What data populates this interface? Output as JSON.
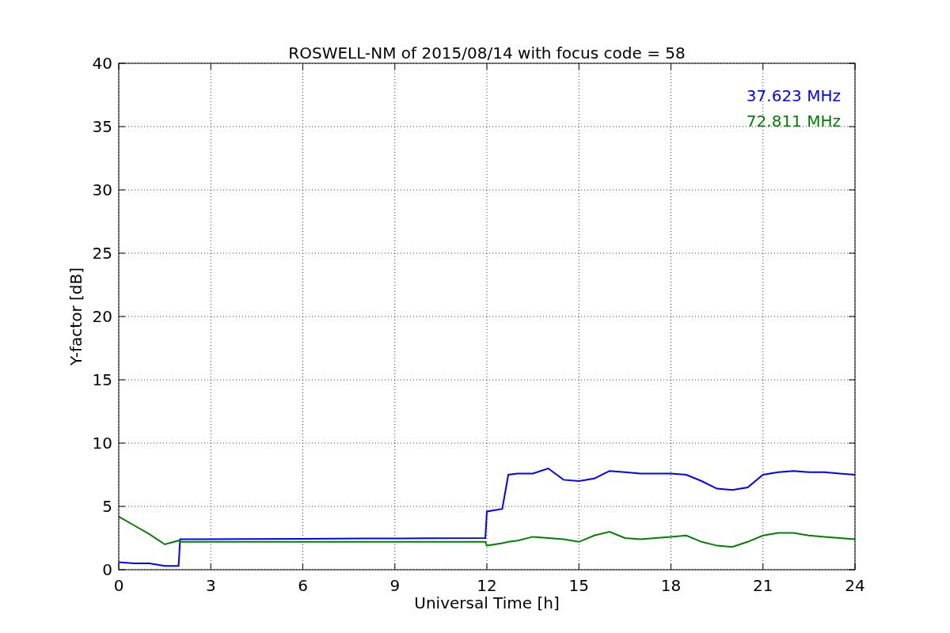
{
  "chart_data": {
    "type": "line",
    "title": "ROSWELL-NM of 2015/08/14 with focus code = 58",
    "xlabel": "Universal Time [h]",
    "ylabel": "Y-factor [dB]",
    "xlim": [
      0,
      24
    ],
    "ylim": [
      0,
      40
    ],
    "xticks": [
      0,
      3,
      6,
      9,
      12,
      15,
      18,
      21,
      24
    ],
    "yticks": [
      0,
      5,
      10,
      15,
      20,
      25,
      30,
      35,
      40
    ],
    "grid": true,
    "x": [
      0,
      0.5,
      1,
      1.5,
      1.95,
      2,
      4,
      6,
      8,
      10,
      11.95,
      12,
      12.5,
      12.7,
      13,
      13.5,
      14,
      14.5,
      15,
      15.5,
      16,
      16.5,
      17,
      17.5,
      18,
      18.5,
      19,
      19.5,
      20,
      20.5,
      21,
      21.5,
      22,
      22.5,
      23,
      23.5,
      24
    ],
    "series": [
      {
        "name": "37.623 MHz",
        "color": "#0000ff",
        "values": [
          0.6,
          0.5,
          0.5,
          0.3,
          0.3,
          2.4,
          2.42,
          2.44,
          2.46,
          2.48,
          2.5,
          4.6,
          4.8,
          7.5,
          7.6,
          7.6,
          8.0,
          7.1,
          7.0,
          7.2,
          7.8,
          7.7,
          7.6,
          7.6,
          7.6,
          7.5,
          7.0,
          6.4,
          6.3,
          6.5,
          7.5,
          7.7,
          7.8,
          7.7,
          7.7,
          7.6,
          7.5
        ]
      },
      {
        "name": "72.811 MHz",
        "color": "#008000",
        "values": [
          4.2,
          3.5,
          2.8,
          2.0,
          2.3,
          2.2,
          2.2,
          2.2,
          2.2,
          2.2,
          2.2,
          1.9,
          2.1,
          2.2,
          2.3,
          2.6,
          2.5,
          2.4,
          2.2,
          2.7,
          3.0,
          2.5,
          2.4,
          2.5,
          2.6,
          2.7,
          2.2,
          1.9,
          1.8,
          2.2,
          2.7,
          2.9,
          2.9,
          2.7,
          2.6,
          2.5,
          2.4
        ]
      }
    ]
  }
}
